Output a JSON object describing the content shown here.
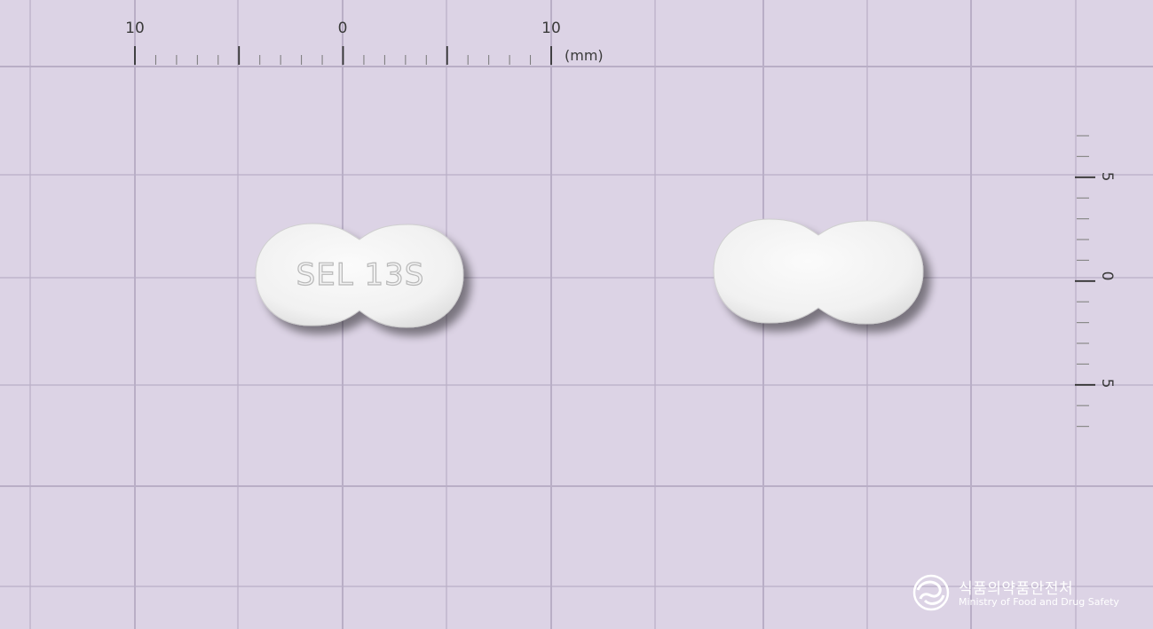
{
  "ruler_top": {
    "labels": [
      "10",
      "0",
      "10"
    ],
    "unit": "(mm)"
  },
  "ruler_right": {
    "labels": [
      "5",
      "0",
      "5"
    ]
  },
  "tablet_front": {
    "imprint": "SEL 13S"
  },
  "watermark": {
    "org_ko": "식품의약품안전처",
    "org_en": "Ministry of Food and Drug Safety"
  },
  "colors": {
    "background": "#dcd3e5",
    "grid_line": "#b9aec6",
    "tablet": "#f4f4f4"
  }
}
